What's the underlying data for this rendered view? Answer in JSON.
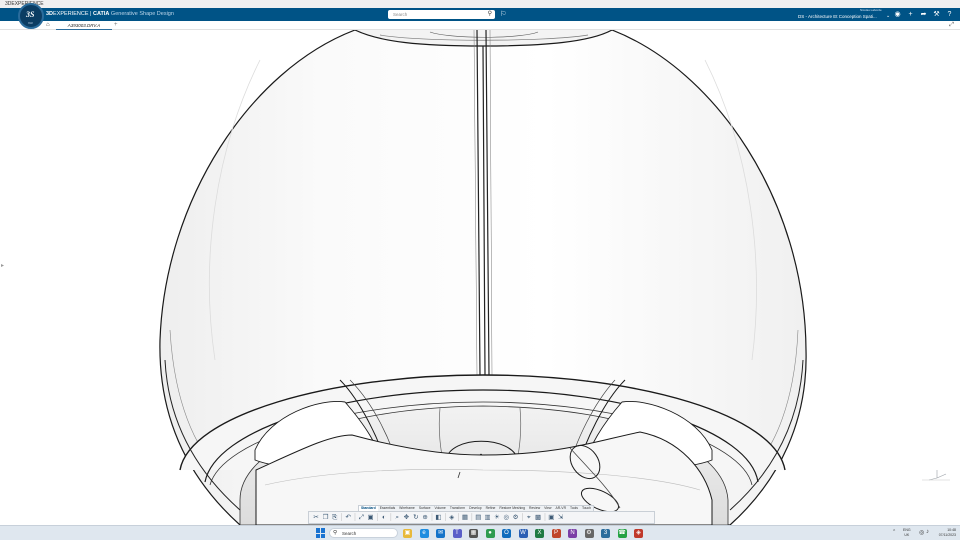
{
  "os": {
    "title": "3DEXPERIENCE"
  },
  "app": {
    "brand_bold": "3D",
    "brand_rest": "EXPERIENCE",
    "separator": " | ",
    "app_bold": "CATIA",
    "app_name": " Generative Shape Design",
    "compass_version": "V.R"
  },
  "search": {
    "placeholder": "Search"
  },
  "user": {
    "name": "Nicolas Laborde",
    "collab_space": "DS - Architecture Et Conception Spati..."
  },
  "tabs": [
    {
      "label": "A393003.DRV.A"
    }
  ],
  "action_bar": {
    "sections": [
      "Standard",
      "Essentials",
      "Wireframe",
      "Surface",
      "Volume",
      "Transform",
      "Develop",
      "Refine",
      "Restore Meshing",
      "Review",
      "View",
      "AR-VR",
      "Tools",
      "Touch"
    ],
    "active_section": "Standard",
    "icons": [
      "cut-icon",
      "copy-icon",
      "paste-icon",
      "sep",
      "undo-icon",
      "sep",
      "zoom-fit-icon",
      "normal-view-icon",
      "sep",
      "hide-show-icon",
      "sep",
      "zoom-area-icon",
      "pan-icon",
      "rotate-icon",
      "zoom-icon",
      "sep",
      "view-mode-icon",
      "sep",
      "render-style-icon",
      "sep",
      "cube-icon",
      "sep",
      "display-icon",
      "layer-icon",
      "lamp-icon",
      "orbit-icon",
      "gear-icon",
      "sep",
      "compass-icon",
      "section-icon",
      "sep",
      "capture-icon",
      "export-icon"
    ]
  },
  "taskbar": {
    "search_label": "Search",
    "apps": [
      "file-explorer",
      "edge",
      "mail",
      "teams",
      "store",
      "chrome",
      "outlook",
      "word",
      "excel",
      "powerpoint",
      "onenote",
      "settings",
      "3dx-app",
      "whatsapp",
      "catia-app"
    ],
    "language": [
      "ENG",
      "UK"
    ],
    "time": "10:48",
    "date": "07/11/2023"
  },
  "colors": {
    "topbar": "#005386",
    "accent": "#2a6c9c",
    "taskbar": "#dfe7ef"
  }
}
